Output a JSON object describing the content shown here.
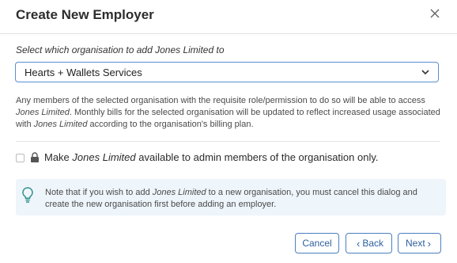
{
  "dialog": {
    "title": "Create New Employer"
  },
  "organisation_select": {
    "label": "Select which organisation to add Jones Limited to",
    "value": "Hearts + Wallets Services"
  },
  "description": {
    "part1": "Any members of the selected organisation with the requisite role/permission to do so will be able to access ",
    "employer1": "Jones Limited",
    "part2": ". Monthly bills for the selected organisation will be updated to reflect increased usage associated with ",
    "employer2": "Jones Limited",
    "part3": " according to the organisation's billing plan."
  },
  "admin_only": {
    "checked": false,
    "prefix": "Make ",
    "employer": "Jones Limited",
    "suffix": " available to admin members of the organisation only."
  },
  "note": {
    "part1": "Note that if you wish to add ",
    "employer": "Jones Limited",
    "part2": " to a new organisation, you must cancel this dialog and create the new organisation first before adding an employer."
  },
  "footer": {
    "cancel_label": "Cancel",
    "back_label": "Back",
    "next_label": "Next"
  },
  "icons": {
    "close": "close-icon",
    "chevron": "chevron-down-icon",
    "lock": "lock-icon",
    "bulb": "lightbulb-icon"
  },
  "colors": {
    "accent": "#4a7fc1",
    "note_background": "#eef5fb",
    "select_border": "#5b8fd0"
  }
}
